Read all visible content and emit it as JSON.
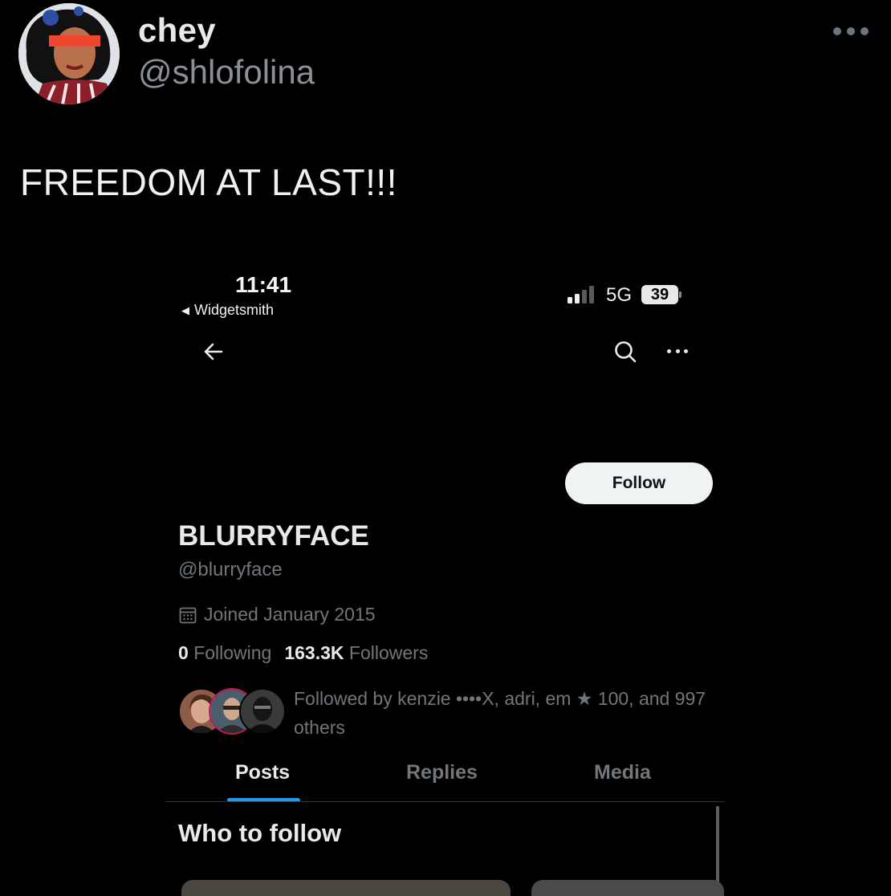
{
  "tweet": {
    "author_name": "chey",
    "author_handle": "@shlofolina",
    "text": "FREEDOM AT LAST!!!",
    "more_icon": "more-horizontal-icon"
  },
  "status_bar": {
    "time": "11:41",
    "back_app": "Widgetsmith",
    "network": "5G",
    "battery": "39"
  },
  "profile": {
    "follow_label": "Follow",
    "name": "BLURRYFACE",
    "handle": "@blurryface",
    "joined": "Joined January 2015",
    "following_count": "0",
    "following_label": "Following",
    "followers_count": "163.3K",
    "followers_label": "Followers",
    "followed_by": "Followed by kenzie ••••X, adri, em ★ 100, and 997 others"
  },
  "tabs": [
    {
      "label": "Posts",
      "active": true
    },
    {
      "label": "Replies",
      "active": false
    },
    {
      "label": "Media",
      "active": false
    }
  ],
  "who_to_follow": {
    "title": "Who to follow"
  },
  "colors": {
    "background": "#000000",
    "accent": "#1d9bf0",
    "muted_text": "#71767b",
    "primary_text": "#e7e9ea"
  }
}
